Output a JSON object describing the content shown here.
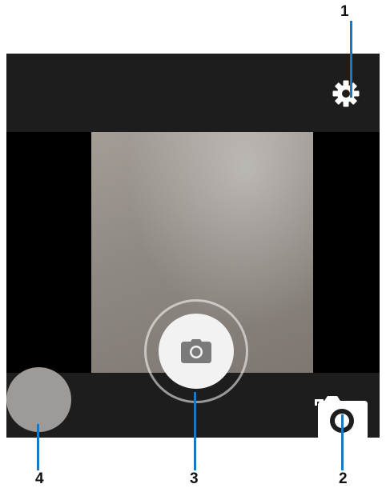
{
  "callouts": {
    "c1": "1",
    "c2": "2",
    "c3": "3",
    "c4": "4"
  },
  "icons": {
    "settings": "gear-icon",
    "shutter": "camera-icon",
    "switch_camera": "switch-camera-icon",
    "thumbnail": "gallery-thumbnail"
  },
  "colors": {
    "bar": "#1d1d1d",
    "screen_bg": "#000000",
    "callout_line": "#1a78c2",
    "shutter": "#f2f2f2",
    "icon_white": "#ffffff",
    "camera_icon": "#7a7a7a"
  }
}
